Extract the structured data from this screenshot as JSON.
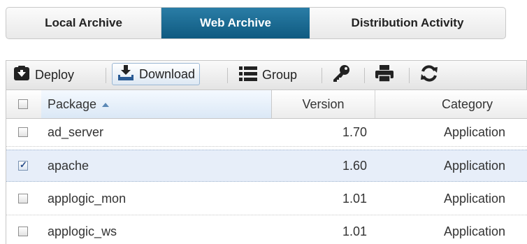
{
  "tabs": [
    {
      "label": "Local Archive",
      "active": false
    },
    {
      "label": "Web Archive",
      "active": true
    },
    {
      "label": "Distribution Activity",
      "active": false
    }
  ],
  "toolbar": {
    "deploy_label": "Deploy",
    "download_label": "Download",
    "group_label": "Group",
    "icons": [
      "deploy-icon",
      "download-icon",
      "group-icon",
      "key-icon",
      "print-icon",
      "refresh-icon"
    ]
  },
  "table": {
    "columns": {
      "package": "Package",
      "version": "Version",
      "category": "Category"
    },
    "sort": {
      "column": "package",
      "direction": "ascending"
    },
    "rows": [
      {
        "package": "ad_server",
        "version": "1.70",
        "category": "Application",
        "checked": false
      },
      {
        "package": "apache",
        "version": "1.60",
        "category": "Application",
        "checked": true
      },
      {
        "package": "applogic_mon",
        "version": "1.01",
        "category": "Application",
        "checked": false
      },
      {
        "package": "applogic_ws",
        "version": "1.01",
        "category": "Application",
        "checked": false
      }
    ]
  },
  "colors": {
    "active_tab": "#1a6a92",
    "selection_row": "#e7eef9",
    "icon_dark": "#222222",
    "download_accent": "#2a5b94"
  }
}
